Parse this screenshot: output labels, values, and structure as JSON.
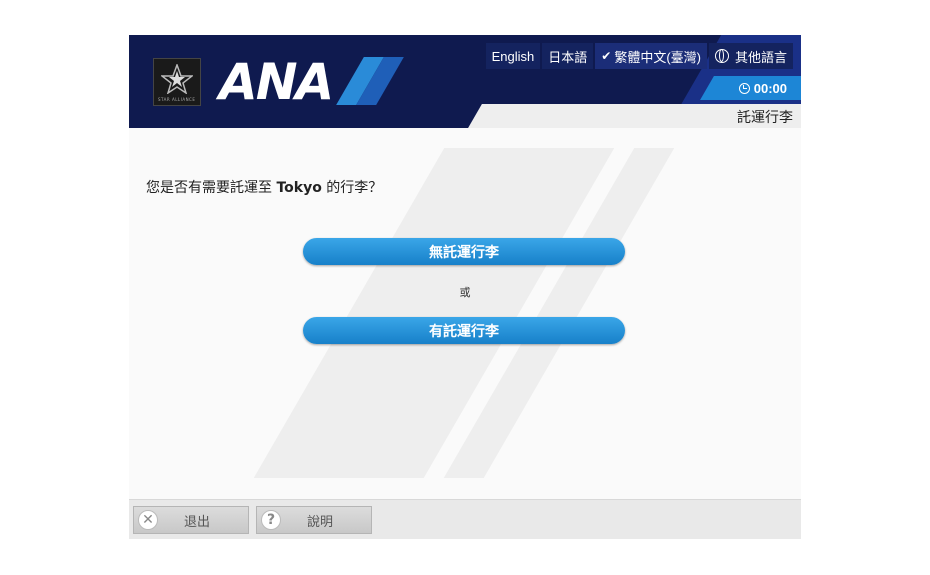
{
  "header": {
    "brand_alliance": "STAR ALLIANCE",
    "brand": "ANA",
    "languages": [
      {
        "label": "English",
        "selected": false
      },
      {
        "label": "日本語",
        "selected": false
      },
      {
        "label": "繁體中文(臺灣)",
        "selected": true
      }
    ],
    "other_languages": "其他語言",
    "timer": "00:00",
    "page_title": "託運行李"
  },
  "main": {
    "question_prefix": "您是否有需要託運至 ",
    "destination": "Tokyo",
    "question_suffix": " 的行李？",
    "option_no_bags": "無託運行李",
    "or_text": "或",
    "option_with_bags": "有託運行李"
  },
  "footer": {
    "exit_label": "退出",
    "help_label": "說明"
  },
  "colors": {
    "header_bg": "#0f1a4f",
    "accent_blue": "#1d86d6",
    "button_blue": "#2594dc"
  }
}
